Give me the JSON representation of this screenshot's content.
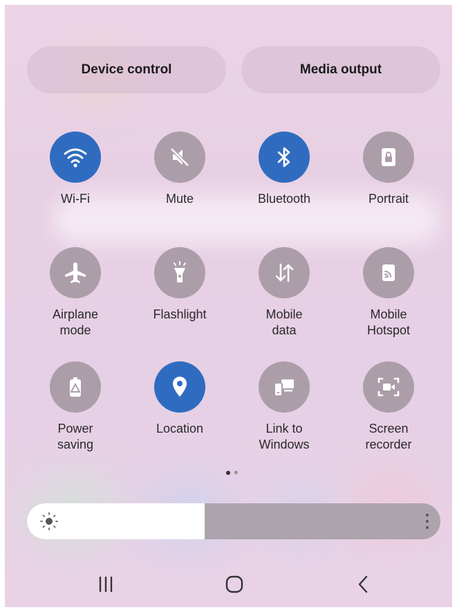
{
  "header": {
    "device_control_label": "Device control",
    "media_output_label": "Media output"
  },
  "tiles": [
    {
      "label": "Wi-Fi",
      "icon": "wifi-icon",
      "active": true
    },
    {
      "label": "Mute",
      "icon": "mute-icon",
      "active": false
    },
    {
      "label": "Bluetooth",
      "icon": "bluetooth-icon",
      "active": true
    },
    {
      "label": "Portrait",
      "icon": "portrait-lock-icon",
      "active": false
    },
    {
      "label": "Airplane\nmode",
      "icon": "airplane-icon",
      "active": false
    },
    {
      "label": "Flashlight",
      "icon": "flashlight-icon",
      "active": false
    },
    {
      "label": "Mobile\ndata",
      "icon": "mobile-data-icon",
      "active": false
    },
    {
      "label": "Mobile\nHotspot",
      "icon": "hotspot-icon",
      "active": false
    },
    {
      "label": "Power\nsaving",
      "icon": "power-saving-icon",
      "active": false
    },
    {
      "label": "Location",
      "icon": "location-icon",
      "active": true
    },
    {
      "label": "Link to\nWindows",
      "icon": "link-to-windows-icon",
      "active": false
    },
    {
      "label": "Screen\nrecorder",
      "icon": "screen-recorder-icon",
      "active": false
    }
  ],
  "pager": {
    "current_page": 1,
    "total_pages": 2
  },
  "brightness": {
    "level_fraction": 0.43
  },
  "colors": {
    "active_tile": "#2f6cc0",
    "inactive_tile": "#ab9ea9",
    "background": "#e8d0e4"
  },
  "navbar": {
    "recents_icon": "recents-icon",
    "home_icon": "home-icon",
    "back_icon": "back-icon"
  }
}
